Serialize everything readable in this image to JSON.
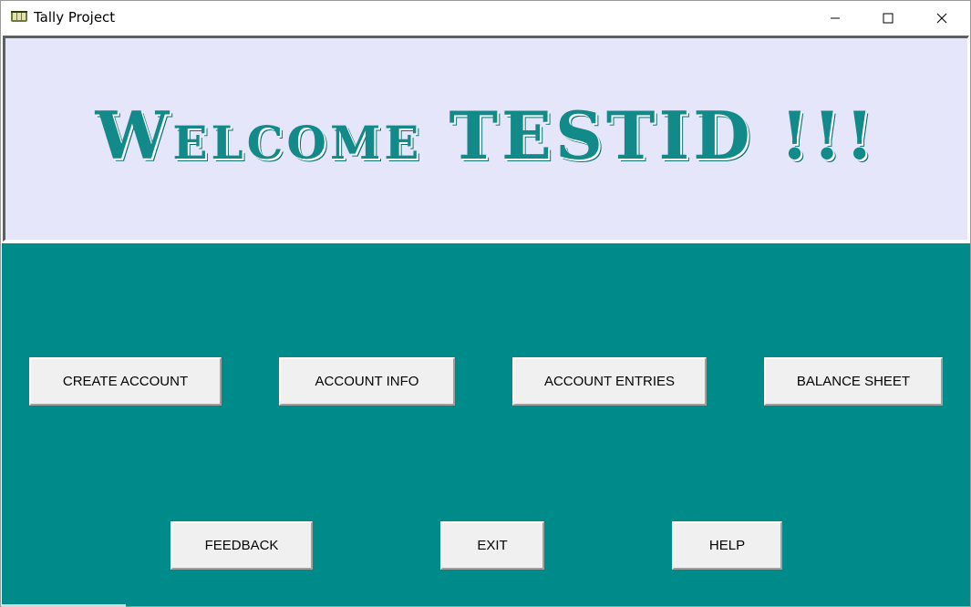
{
  "window": {
    "title": "Tally Project"
  },
  "header": {
    "welcome": "Welcome TESTID !!!"
  },
  "buttons": {
    "create_account": "CREATE ACCOUNT",
    "account_info": "ACCOUNT INFO",
    "account_entries": "ACCOUNT ENTRIES",
    "balance_sheet": "BALANCE SHEET",
    "feedback": "FEEDBACK",
    "exit": "EXIT",
    "help": "HELP"
  },
  "colors": {
    "header_bg": "#e6e6fa",
    "main_bg": "#008b8b",
    "welcome_text": "#138a8a",
    "button_bg": "#f0f0f0"
  },
  "icons": {
    "app": "tally-app-icon",
    "minimize": "minimize-icon",
    "maximize": "maximize-icon",
    "close": "close-icon"
  }
}
